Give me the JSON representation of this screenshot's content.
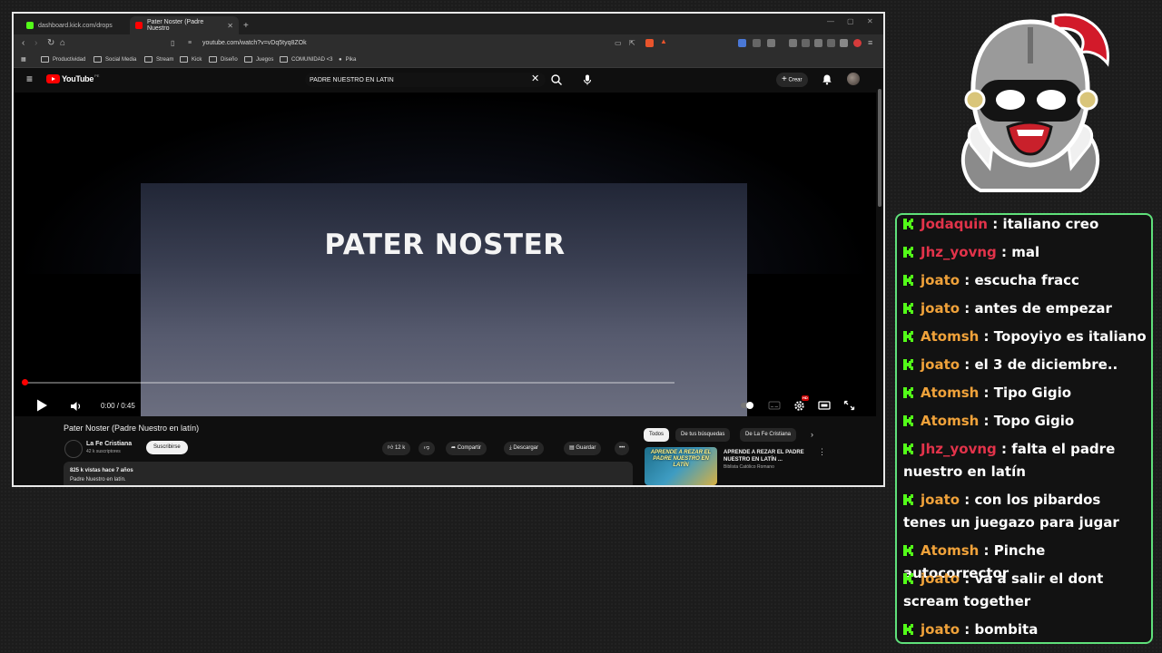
{
  "browser": {
    "tabs": [
      {
        "label": "dashboard.kick.com/drops",
        "active": false
      },
      {
        "label": "Pater Noster (Padre Nuestro",
        "active": true
      }
    ],
    "new_tab": "+",
    "url": "youtube.com/watch?v=vDq5tyq8ZOk",
    "bookmarks": [
      "Productividad",
      "Social Media",
      "Stream",
      "Kick",
      "Diseño",
      "Juegos",
      "COMUNIDAD <3",
      "Pika"
    ]
  },
  "youtube": {
    "logo": "YouTube",
    "country": "PE",
    "search_query": "PADRE NUESTRO EN LATIN",
    "create_label": "Crear",
    "video_overlay_title": "PATER NOSTER",
    "time": "0:00 / 0:45",
    "progress_fraction": 0.0,
    "hd_badge": "HD",
    "video_title": "Pater Noster (Padre Nuestro en latín)",
    "channel": "La Fe Cristiana",
    "subscribers": "42 k suscriptores",
    "subscribe_label": "Suscribirse",
    "actions": {
      "likes": "12 k",
      "share": "Compartir",
      "download": "Descargar",
      "save": "Guardar"
    },
    "description_stats": "825 k vistas  hace 7 años",
    "description_text": "Padre Nuestro en latín.",
    "chips": [
      "Todos",
      "De tus búsquedas",
      "De La Fe Cristiana"
    ],
    "recommendation": {
      "thumb_text": "APRENDE A REZAR EL PADRE NUESTRO EN LATÍN",
      "title": "APRENDE A REZAR EL PADRE NUESTRO EN LATÍN ...",
      "channel": "Biblista Católico Romano"
    }
  },
  "chat": {
    "messages": [
      {
        "user": "Jodaquin",
        "color": "#e2334a",
        "text": "italiano creo"
      },
      {
        "user": "Jhz_yovng",
        "color": "#e2334a",
        "text": "mal"
      },
      {
        "user": "joato",
        "color": "#f0a23a",
        "text": "escucha fracc"
      },
      {
        "user": "joato",
        "color": "#f0a23a",
        "text": "antes de empezar"
      },
      {
        "user": "Atomsh",
        "color": "#f0a23a",
        "text": "Topoyiyo es italiano"
      },
      {
        "user": "joato",
        "color": "#f0a23a",
        "text": "el 3 de diciembre.."
      },
      {
        "user": "Atomsh",
        "color": "#f0a23a",
        "text": "Tipo Gigio"
      },
      {
        "user": "Atomsh",
        "color": "#f0a23a",
        "text": "Topo Gigio"
      },
      {
        "user": "Jhz_yovng",
        "color": "#e2334a",
        "text": "falta el padre nuestro en latín"
      },
      {
        "user": "joato",
        "color": "#f0a23a",
        "text": "con los pibardos tenes un juegazo para jugar"
      },
      {
        "user": "Atomsh",
        "color": "#f0a23a",
        "text": "Pinche autocorrector"
      },
      {
        "user": "joato",
        "color": "#f0a23a",
        "text": "va a salir el dont scream together"
      },
      {
        "user": "joato",
        "color": "#f0a23a",
        "text": "bombita"
      }
    ],
    "separator": " : "
  },
  "colors": {
    "kick_green": "#53fc18",
    "chat_border": "#5fe07a",
    "yt_red": "#ff0000"
  }
}
